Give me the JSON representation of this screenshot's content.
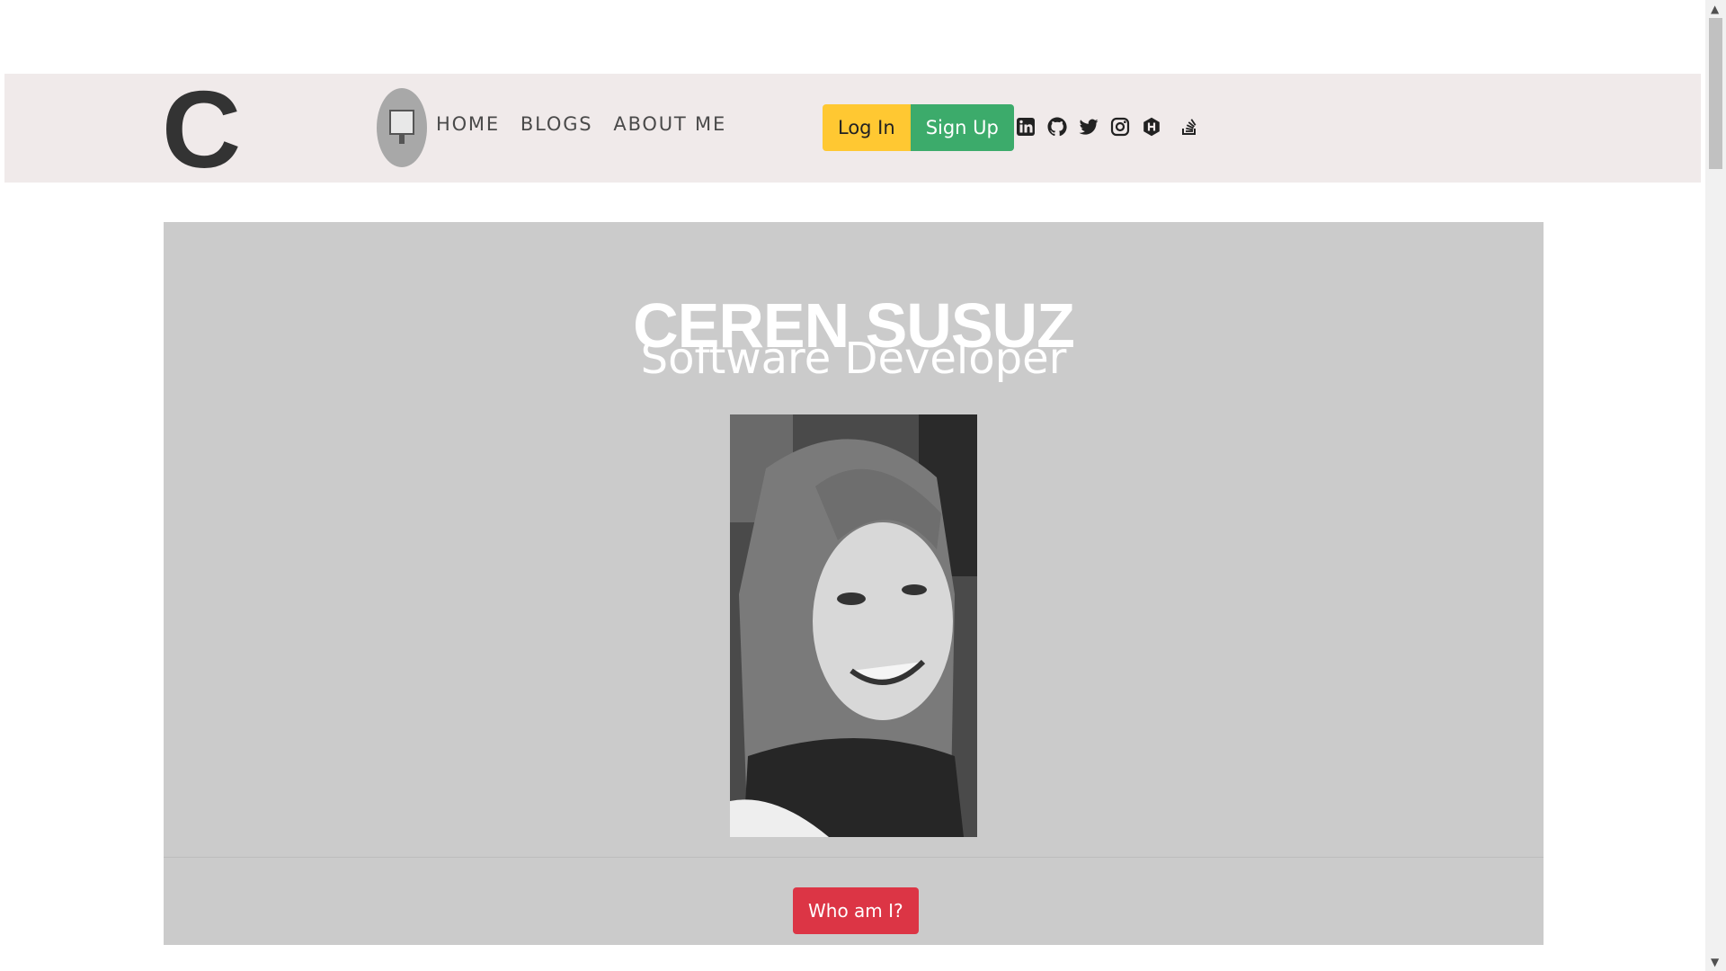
{
  "navbar": {
    "logo_letter": "C",
    "links": [
      {
        "label": "HOME"
      },
      {
        "label": "BLOGS"
      },
      {
        "label": "ABOUT ME"
      }
    ],
    "login_label": "Log In",
    "signup_label": "Sign Up",
    "social_icons": [
      "linkedin-icon",
      "github-icon",
      "twitter-icon",
      "instagram-icon",
      "hashnode-icon",
      "stackoverflow-icon"
    ]
  },
  "hero": {
    "name": "CEREN SUSUZ",
    "role": "Software Developer",
    "cta_label": "Who am I?"
  },
  "colors": {
    "navbar_bg": "#f0eaea",
    "card_bg": "#cbcbcb",
    "login": "#ffc832",
    "signup": "#3cab6b",
    "cta": "#dc3545"
  }
}
